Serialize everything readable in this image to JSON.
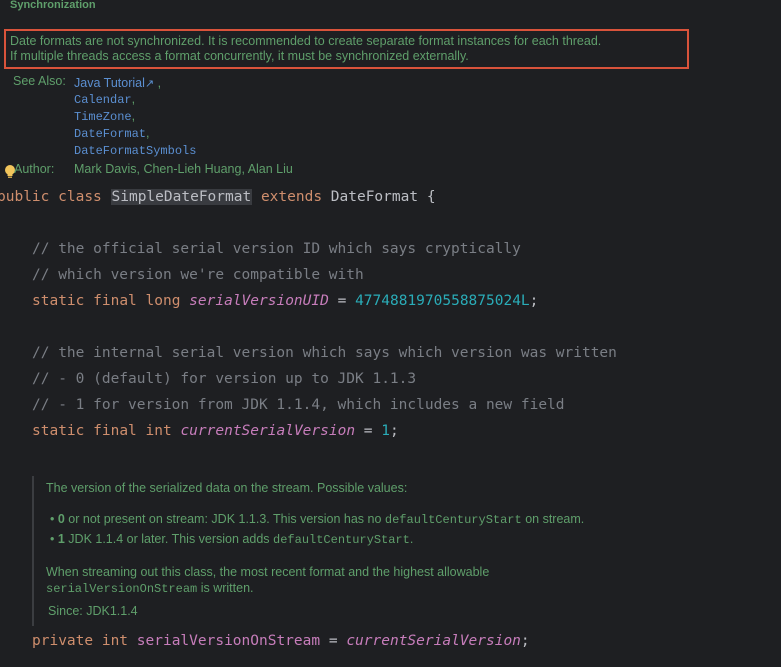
{
  "javadoc_top": {
    "section_heading": "Synchronization",
    "sync_line1": "Date formats are not synchronized. It is recommended to create separate format instances for each thread.",
    "sync_line2": "If multiple threads access a format concurrently, it must be synchronized externally.",
    "see_also_label": "See Also:",
    "see_also": [
      {
        "text": "Java Tutorial",
        "suffix": "↗",
        "sep": " ,"
      },
      {
        "text": "Calendar",
        "sep": ","
      },
      {
        "text": "TimeZone",
        "sep": ","
      },
      {
        "text": "DateFormat",
        "sep": ","
      },
      {
        "text": "DateFormatSymbols",
        "sep": ""
      }
    ],
    "author_label": "Author:",
    "author_value": "Mark Davis, Chen-Lieh Huang, Alan Liu"
  },
  "code": {
    "class_decl": {
      "kw1": "public",
      "kw2": "class",
      "class_name": "SimpleDateFormat",
      "kw3": "extends",
      "parent": "DateFormat",
      "brace": "{"
    },
    "comment1": "// the official serial version ID which says cryptically",
    "comment2": "// which version we're compatible with",
    "serial_decl": {
      "kw1": "static",
      "kw2": "final",
      "type": "long",
      "name": "serialVersionUID",
      "eq": " = ",
      "value": "4774881970558875024L",
      "semi": ";"
    },
    "comment3": "// the internal serial version which says which version was written",
    "comment4": "// - 0 (default) for version up to JDK 1.1.3",
    "comment5": "// - 1 for version from JDK 1.1.4, which includes a new field",
    "current_decl": {
      "kw1": "static",
      "kw2": "final",
      "type": "int",
      "name": "currentSerialVersion",
      "eq": " = ",
      "value": "1",
      "semi": ";"
    },
    "stream_decl": {
      "kw1": "private",
      "type": "int",
      "name": "serialVersionOnStream",
      "eq": " = ",
      "value": "currentSerialVersion",
      "semi": ";"
    }
  },
  "javadoc_inline": {
    "intro": "The version of the serialized data on the stream. Possible values:",
    "bullet1": {
      "bold": "0",
      "text": " or not present on stream: JDK 1.1.3. This version has no ",
      "code": "defaultCenturyStart",
      "tail": " on stream."
    },
    "bullet2": {
      "bold": "1",
      "text": " JDK 1.1.4 or later. This version adds ",
      "code": "defaultCenturyStart",
      "tail": "."
    },
    "para_line1": "When streaming out this class, the most recent format and the highest allowable",
    "para_code": "serialVersionOnStream",
    "para_tail": " is written.",
    "since": "Since: JDK1.1.4"
  },
  "colors": {
    "background": "#1e1f22",
    "doc_text": "#5f9f6b",
    "link": "#5b8fd1",
    "keyword": "#cf8e6d",
    "comment": "#7a7e85",
    "number": "#2aacb8",
    "field": "#c77dbb",
    "highlight_box": "#d9533b"
  },
  "icons": {
    "intention": "lightbulb-icon"
  }
}
